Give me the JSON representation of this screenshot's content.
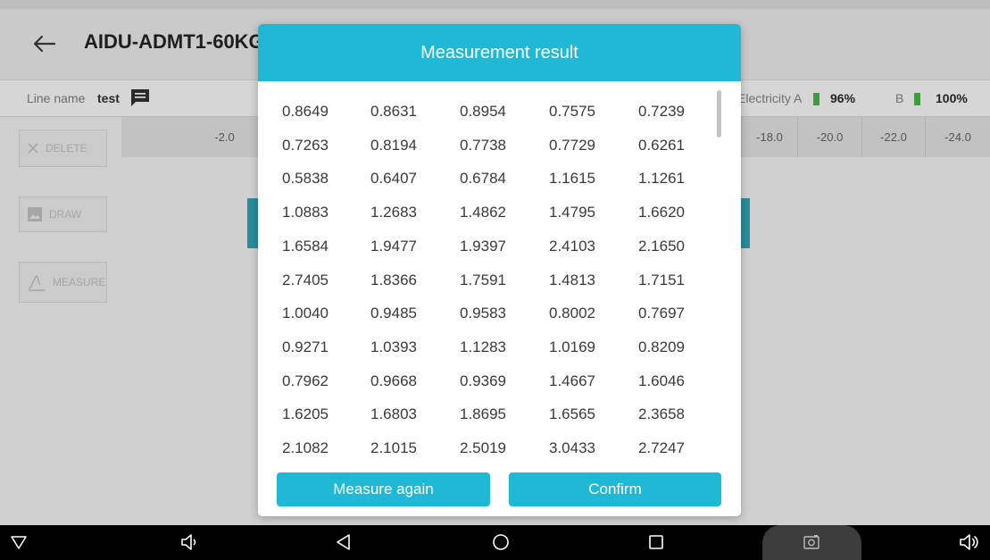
{
  "app": {
    "title": "AIDU-ADMT1-60KG-"
  },
  "info": {
    "line_name_label": "Line name",
    "line_name_value": "test",
    "electricity_label": "Electricity A",
    "battery_a": "96%",
    "battery_b_label": "B",
    "battery_b": "100%"
  },
  "side_buttons": {
    "delete": "DELETE",
    "draw": "DRAW",
    "measure": "MEASURE"
  },
  "axis_ticks": [
    "-2.0",
    "-18.0",
    "-20.0",
    "-22.0",
    "-24.0"
  ],
  "dialog": {
    "title": "Measurement result",
    "rows": [
      [
        "0.8649",
        "0.8631",
        "0.8954",
        "0.7575",
        "0.7239"
      ],
      [
        "0.7263",
        "0.8194",
        "0.7738",
        "0.7729",
        "0.6261"
      ],
      [
        "0.5838",
        "0.6407",
        "0.6784",
        "1.1615",
        "1.1261"
      ],
      [
        "1.0883",
        "1.2683",
        "1.4862",
        "1.4795",
        "1.6620"
      ],
      [
        "1.6584",
        "1.9477",
        "1.9397",
        "2.4103",
        "2.1650"
      ],
      [
        "2.7405",
        "1.8366",
        "1.7591",
        "1.4813",
        "1.7151"
      ],
      [
        "1.0040",
        "0.9485",
        "0.9583",
        "0.8002",
        "0.7697"
      ],
      [
        "0.9271",
        "1.0393",
        "1.1283",
        "1.0169",
        "0.8209"
      ],
      [
        "0.7962",
        "0.9668",
        "0.9369",
        "1.4667",
        "1.6046"
      ],
      [
        "1.6205",
        "1.6803",
        "1.8695",
        "1.6565",
        "2.3658"
      ],
      [
        "2.1082",
        "2.1015",
        "2.5019",
        "3.0433",
        "2.7247"
      ]
    ],
    "measure_again_label": "Measure again",
    "confirm_label": "Confirm"
  },
  "colors": {
    "accent": "#1fb9d6",
    "battery_green": "#3b9e3b"
  },
  "icons": {
    "back": "back-arrow-icon",
    "line_name": "chat-icon",
    "delete": "close-icon",
    "draw": "image-icon",
    "measure": "measure-icon",
    "nav": [
      "nav-down-icon",
      "volume-down-icon",
      "nav-back-icon",
      "nav-home-icon",
      "nav-recents-icon",
      "screenshot-icon",
      "volume-up-icon"
    ]
  }
}
